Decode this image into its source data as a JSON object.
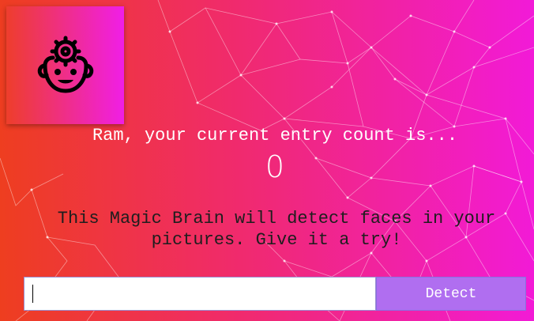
{
  "logo": {
    "icon": "brain-face-icon"
  },
  "rank": {
    "message": "Ram, your current entry count is...",
    "count": "0"
  },
  "description": {
    "text": "This Magic Brain will detect faces in your pictures. Give it a try!"
  },
  "form": {
    "input_value": "",
    "input_placeholder": "",
    "detect_label": "Detect"
  },
  "colors": {
    "bg_start": "#ee3e1f",
    "bg_end": "#f21ad8",
    "button": "#b06ef0"
  }
}
